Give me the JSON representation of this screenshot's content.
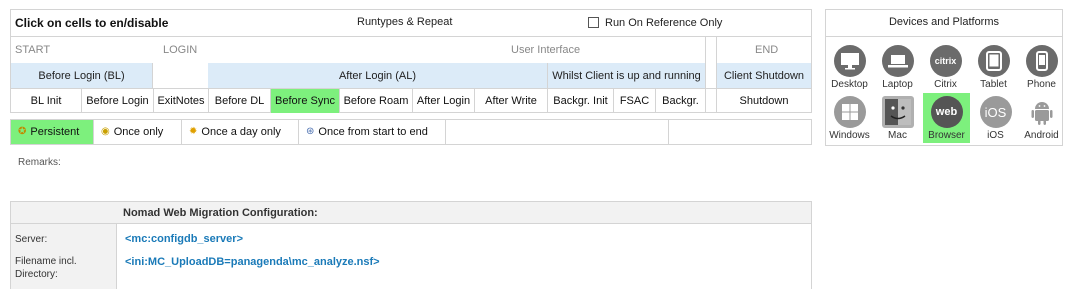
{
  "runtypes": {
    "header_title": "Click on cells to en/disable",
    "header_center": "Runtypes & Repeat",
    "run_on_reference_label": "Run On Reference Only",
    "run_on_reference_checked": false,
    "sections": {
      "start": "START",
      "login": "LOGIN",
      "ui": "User Interface",
      "end": "END"
    },
    "groups": {
      "before_login": "Before Login (BL)",
      "after_login": "After Login (AL)",
      "whilst_client": "Whilst Client is up and running",
      "client_shutdown": "Client Shutdown"
    },
    "steps": {
      "bl_init": "BL Init",
      "before_login": "Before Login",
      "exit_notes": "ExitNotes",
      "before_dl": "Before DL",
      "before_sync": "Before Sync",
      "before_roam": "Before Roam",
      "after_login": "After Login",
      "after_write": "After Write",
      "backgr_init": "Backgr. Init",
      "fsac": "FSAC",
      "backgr": "Backgr.",
      "shutdown": "Shutdown"
    },
    "active_step": "Before Sync"
  },
  "frequency": {
    "persistent": "Persistent",
    "once_only": "Once only",
    "once_a_day": "Once a day only",
    "once_start_end": "Once from start to end",
    "selected": "Persistent"
  },
  "remarks_label": "Remarks:",
  "nomad": {
    "title": "Nomad Web Migration Configuration:",
    "server_label": "Server:",
    "server_value": "<mc:configdb_server>",
    "filename_label_1": "Filename incl.",
    "filename_label_2": "Directory:",
    "filename_value": "<ini:MC_UploadDB=panagenda\\mc_analyze.nsf>"
  },
  "devices": {
    "title": "Devices and Platforms",
    "items": {
      "desktop": "Desktop",
      "laptop": "Laptop",
      "citrix": "Citrix",
      "tablet": "Tablet",
      "phone": "Phone",
      "windows": "Windows",
      "mac": "Mac",
      "browser": "Browser",
      "ios": "iOS",
      "android": "Android"
    },
    "citrix_icon_text": "citrix",
    "browser_icon_text": "web",
    "ios_icon_text": "iOS",
    "selected": "Browser"
  },
  "colors": {
    "active_green": "#7df07d",
    "group_blue": "#dcebf8",
    "value_blue": "#1a7ab8",
    "icon_gray": "#6b6b6b"
  }
}
